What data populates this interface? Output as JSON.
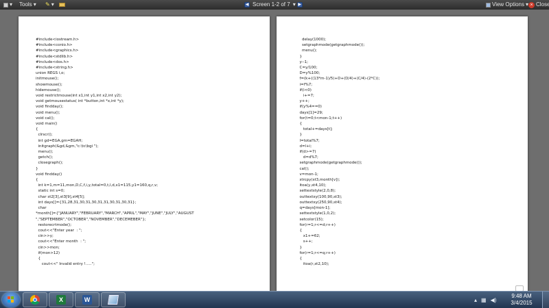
{
  "toolbar": {
    "tools_label": "Tools",
    "screen_label": "Screen 1-2 of 7",
    "view_options_label": "View Options",
    "close_label": "Close"
  },
  "pages": {
    "left_code": "#include<iostream.h>\n#include<conio.h>\n#include<graphics.h>\n#include<stdlib.h>\n#include<dos.h>\n#include<string.h>\nunion REGS i,o;\ninitmouse();\nshowmouse();\nhidemouse();\nvoid restrictmouse(int x1,int y1,int x2,int y2);\nvoid getmousestatus( int *button,int *x,int *y);\nvoid findday();\nvoid menu();\nvoid cal();\nvoid main()\n{\n  clrscr();\n  int gd=EGA,gm=EGAH;\n  initgraph(&gd,&gm,\"c:\\tc\\bgi \");\n  menu();\n  getch();\n  closegraph();\n}\nvoid findday()\n{\n  int k=1,m=11,mon,D,C,f,i,y,total=0,t,l,d,x1=115,y1=160,q,r,v;\n  static int s=0;\n  char st2[3],st3[9],st4[5];\n  int days[]={31,28,31,30,31,30,31,31,30,31,30,31};\n  char\n*month[]={\"JANUARY\",\"FEBRUARY\",\"MARCH\",\"APRIL\",\"MAY\",\"JUNE\",\"JULY\",\"AUGUST\n\",\"SEPTEMBER\",\"OCTOBER\",\"NOVEMBER\",\"DECEMEBER\"};\n  restorecrtmode();\n  cout<<\"Enter year  : \";\n  cin>>y;\n  cout<<\"Enter month  : \";\n  cin>>mon;\n  if(mon>12)\n  {\n     cout<<\" Invalid entry !.....\";",
    "right_code": "    delay(1000);\n    setgraphmode(getgraphmode());\n    menu();\n  }\n  y--1;\n  C=y/100;\n  D=y%100;\n  f=(k+((13*m-1)/5)+D+(D/4)+(C/4)-(2*C));\n  i=f%7;\n  if(i<0)\n     i+=7;\n  y++;\n  if(y%4==0)\n  days[1]=29;\n  for(t=0;t<mon-1;t++)\n  {\n     total+=days[t];\n  }\n  l=total%7;\n  d=l+i;\n  if(d>=7)\n     d=d%7;\n  setgraphmode(getgraphmode());\n  cal();\n  v=mon-1;\n  strcpy(st3,month[v]);\n  itoa(y,st4,10);\n  settextstyle(2,0,8);\n  outtextxy(100,90,st3);\n  outtextxy(250,90,st4);\n  q=days[mon-1];\n  settextstyle(1,0,2);\n  setcolor(15);\n  for(r=1;r<=d;r++)\n  {\n     x1+=62;\n     s++;\n  }\n  for(r=1;r<=q;r++)\n  {\n     itoa(r,st2,10);"
  },
  "taskbar": {
    "apps": [
      {
        "icon": "chrome-icon"
      },
      {
        "icon": "excel-icon"
      },
      {
        "icon": "word-icon"
      },
      {
        "icon": "picture-viewer-icon"
      }
    ],
    "clock_time": "9:48 AM",
    "clock_date": "3/4/2015"
  },
  "colors": {
    "toolbar_bg": "#2c2c2c",
    "page_bg": "#ffffff",
    "taskbar_bg": "#223550",
    "text": "#1a1a1a"
  }
}
